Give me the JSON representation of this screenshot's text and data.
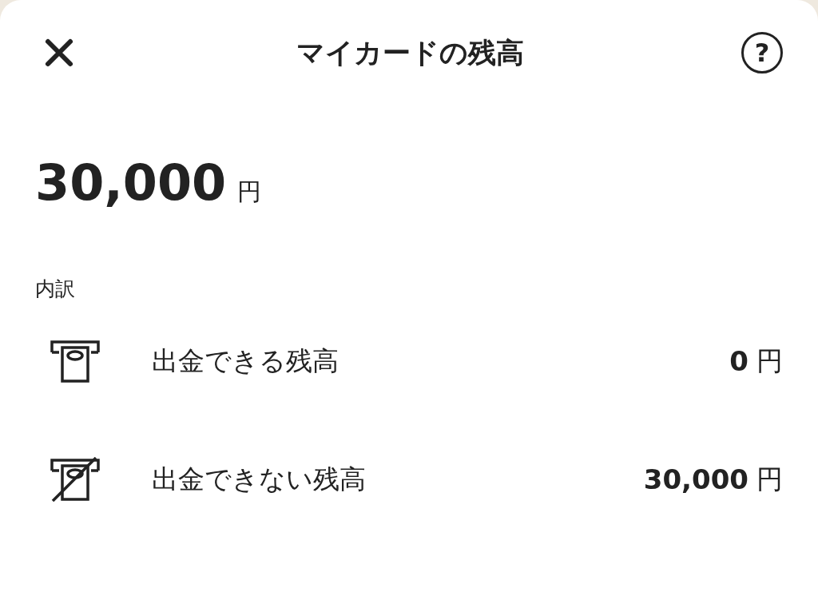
{
  "header": {
    "title": "マイカードの残高",
    "help": "?"
  },
  "balance": {
    "amount": "30,000",
    "unit": "円"
  },
  "breakdown": {
    "label": "内訳",
    "rows": [
      {
        "kind": "withdrawable",
        "label": "出金できる残高",
        "amount": "0",
        "unit": "円"
      },
      {
        "kind": "not-withdrawable",
        "label": "出金できない残高",
        "amount": "30,000",
        "unit": "円"
      }
    ]
  }
}
